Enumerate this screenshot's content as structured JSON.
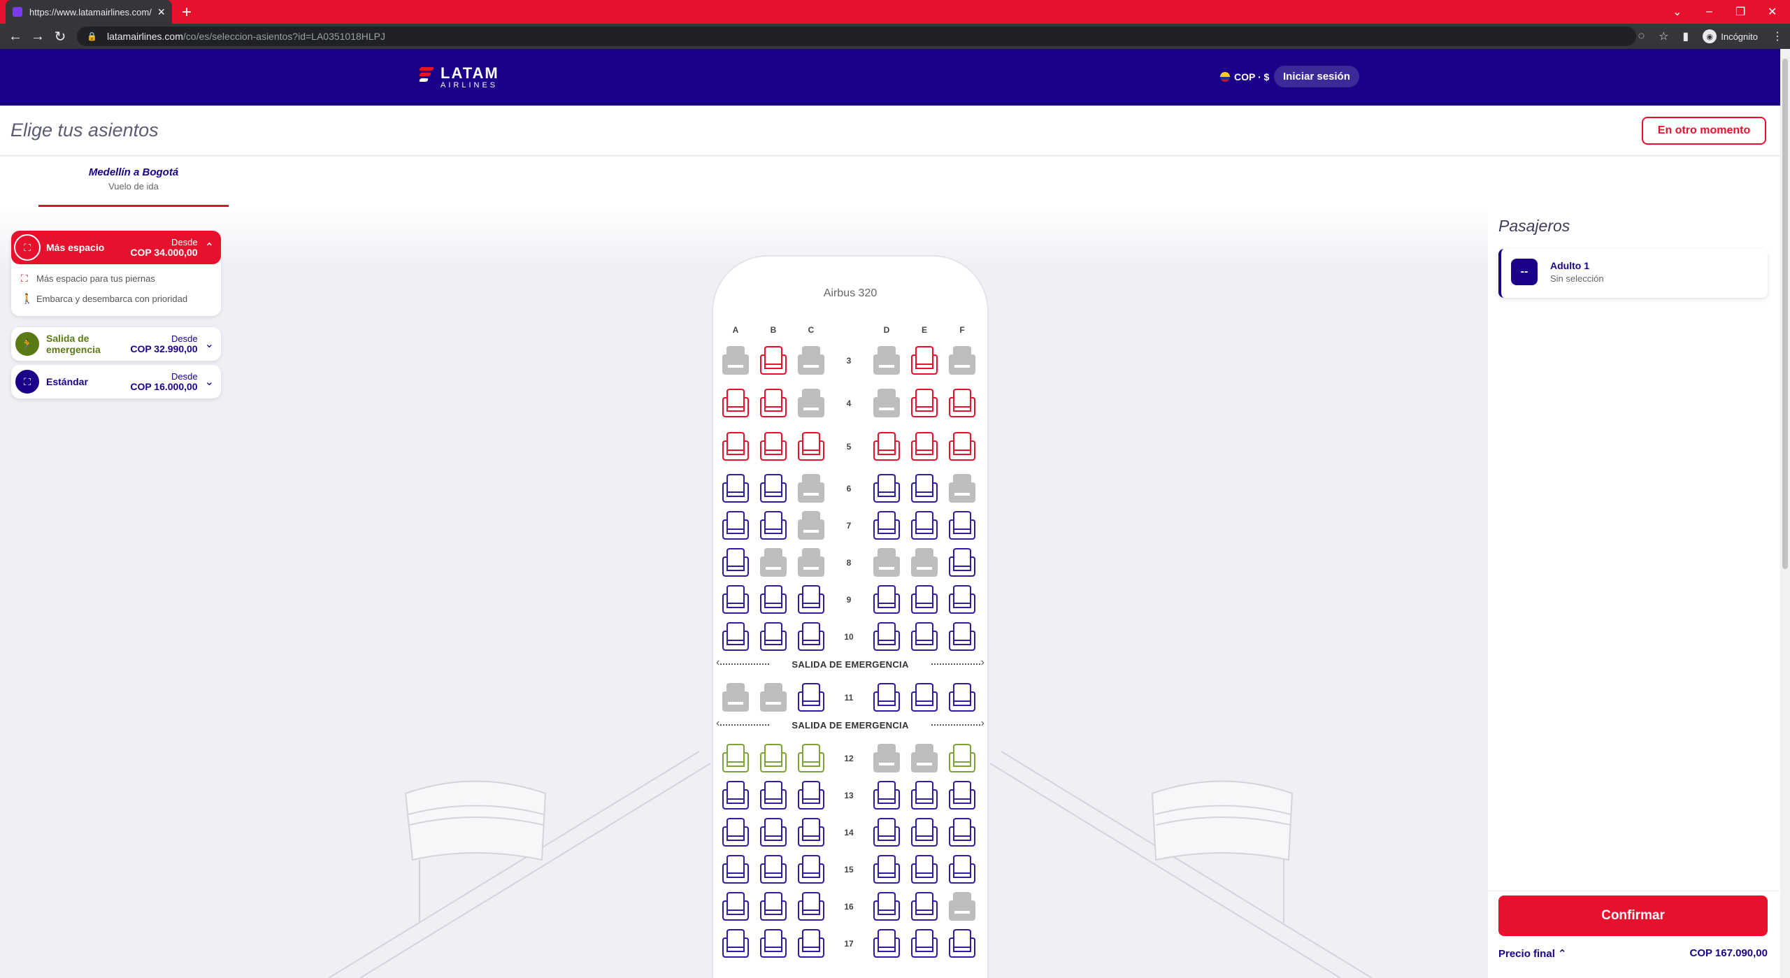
{
  "browser": {
    "tab_title": "https://www.latamairlines.com/co",
    "url_host": "latamairlines.com",
    "url_path": "/co/es/seleccion-asientos?id=LA0351018HLPJ",
    "profile_label": "Incógnito"
  },
  "header": {
    "logo_word": "LATAM",
    "logo_sub": "AIRLINES",
    "currency": "COP · $",
    "login_label": "Iniciar sesión"
  },
  "page": {
    "title": "Elige tus asientos",
    "later_label": "En otro momento"
  },
  "flight": {
    "route": "Medellín a Bogotá",
    "type": "Vuelo de ida"
  },
  "cabins": [
    {
      "name": "Más espacio",
      "from_label": "Desde",
      "price": "COP 34.000,00",
      "color": "#e8112d",
      "expanded": true,
      "features": [
        "Más espacio para tus piernas",
        "Embarca y desembarca con prioridad"
      ]
    },
    {
      "name": "Salida de emergencia",
      "from_label": "Desde",
      "price": "COP 32.990,00",
      "color": "#5a7a14",
      "expanded": false
    },
    {
      "name": "Estándar",
      "from_label": "Desde",
      "price": "COP 16.000,00",
      "color": "#1b0088",
      "expanded": false
    }
  ],
  "seatmap": {
    "aircraft": "Airbus 320",
    "columns": [
      "A",
      "B",
      "C",
      "D",
      "E",
      "F"
    ],
    "exit_label": "SALIDA DE EMERGENCIA",
    "colors": {
      "plus": "#e8112d",
      "exit": "#7da23a",
      "standard": "#2d1da0",
      "occupied": "#bdbdbd"
    },
    "rows": [
      {
        "num": "3",
        "seats": [
          "occupied",
          "plus",
          "occupied",
          "occupied",
          "plus",
          "occupied"
        ]
      },
      {
        "num": "4",
        "seats": [
          "plus",
          "plus",
          "occupied",
          "occupied",
          "plus",
          "plus"
        ]
      },
      {
        "num": "5",
        "seats": [
          "plus",
          "plus",
          "plus",
          "plus",
          "plus",
          "plus"
        ]
      },
      {
        "num": "6",
        "seats": [
          "standard",
          "standard",
          "occupied",
          "standard",
          "standard",
          "occupied"
        ]
      },
      {
        "num": "7",
        "seats": [
          "standard",
          "standard",
          "occupied",
          "standard",
          "standard",
          "standard"
        ]
      },
      {
        "num": "8",
        "seats": [
          "standard",
          "occupied",
          "occupied",
          "occupied",
          "occupied",
          "standard"
        ]
      },
      {
        "num": "9",
        "seats": [
          "standard",
          "standard",
          "standard",
          "standard",
          "standard",
          "standard"
        ]
      },
      {
        "num": "10",
        "seats": [
          "standard",
          "standard",
          "standard",
          "standard",
          "standard",
          "standard"
        ]
      },
      {
        "exit": true
      },
      {
        "num": "11",
        "seats": [
          "occupied",
          "occupied",
          "standard",
          "standard",
          "standard",
          "standard"
        ]
      },
      {
        "exit": true
      },
      {
        "num": "12",
        "seats": [
          "exit",
          "exit",
          "exit",
          "occupied",
          "occupied",
          "exit"
        ]
      },
      {
        "num": "13",
        "seats": [
          "standard",
          "standard",
          "standard",
          "standard",
          "standard",
          "standard"
        ]
      },
      {
        "num": "14",
        "seats": [
          "standard",
          "standard",
          "standard",
          "standard",
          "standard",
          "standard"
        ]
      },
      {
        "num": "15",
        "seats": [
          "standard",
          "standard",
          "standard",
          "standard",
          "standard",
          "standard"
        ]
      },
      {
        "num": "16",
        "seats": [
          "standard",
          "standard",
          "standard",
          "standard",
          "standard",
          "occupied"
        ]
      },
      {
        "num": "17",
        "seats": [
          "standard",
          "standard",
          "standard",
          "standard",
          "standard",
          "standard"
        ]
      }
    ]
  },
  "passengers": {
    "title": "Pasajeros",
    "list": [
      {
        "badge": "--",
        "name": "Adulto 1",
        "selection": "Sin selección"
      }
    ]
  },
  "footer": {
    "confirm_label": "Confirmar",
    "final_price_label": "Precio final",
    "final_price_value": "COP 167.090,00"
  }
}
